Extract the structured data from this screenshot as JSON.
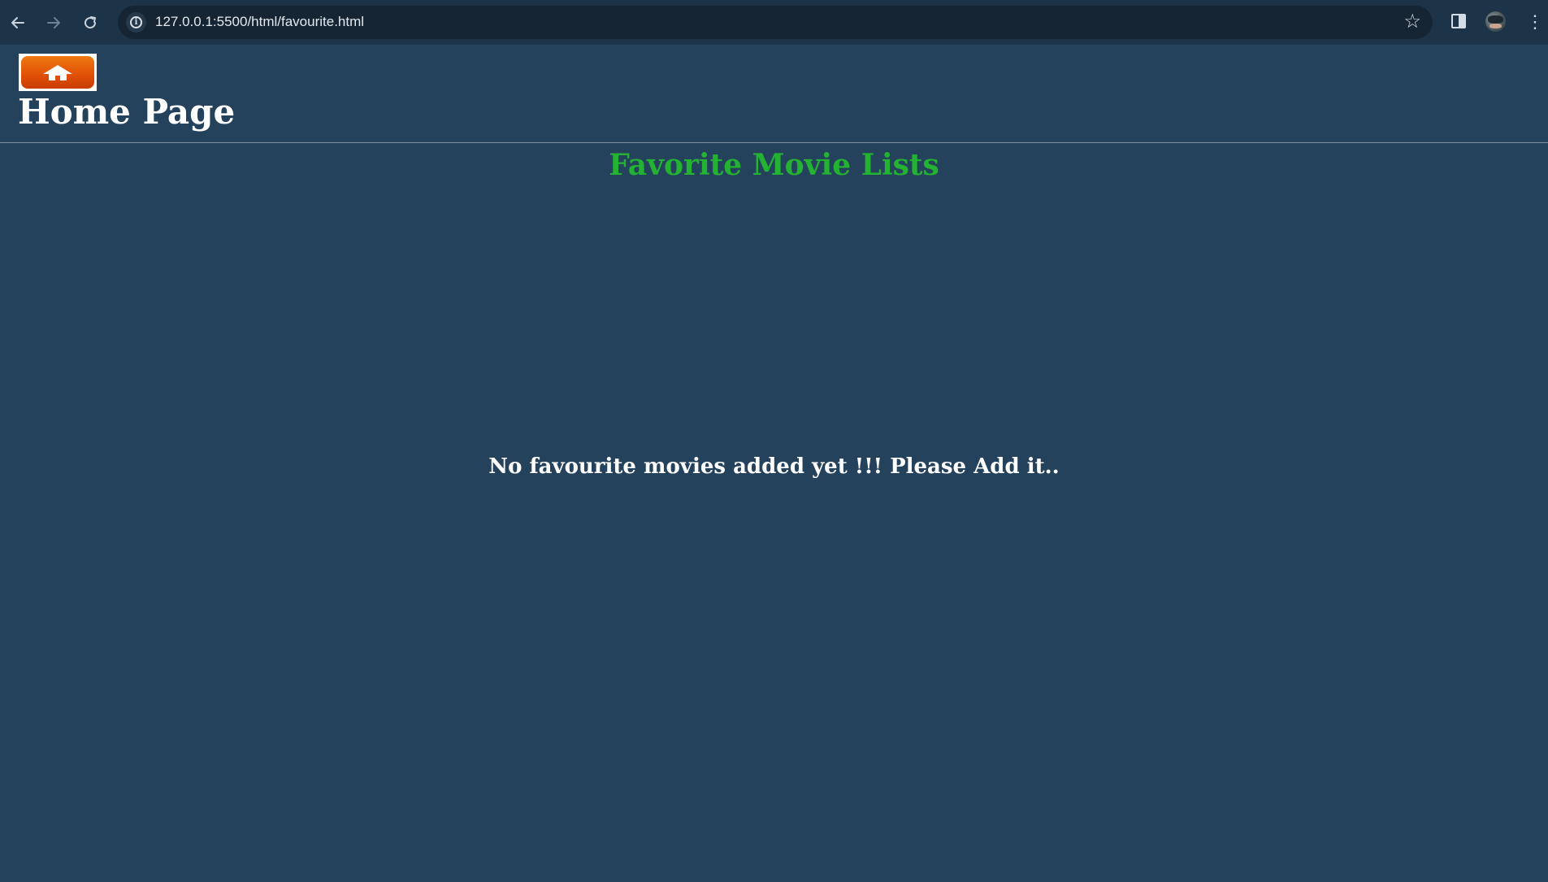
{
  "browser": {
    "url": "127.0.0.1:5500/html/favourite.html",
    "back_icon": "arrow-left-icon",
    "forward_icon": "arrow-right-icon",
    "reload_icon": "reload-icon",
    "site_info_icon": "info-icon",
    "bookmark_icon": "star-icon",
    "side_panel_icon": "side-panel-icon",
    "profile_icon": "avatar",
    "menu_icon": "more-vertical-icon"
  },
  "header": {
    "home_button_icon": "home-icon",
    "title": "Home Page"
  },
  "main": {
    "heading": "Favorite Movie Lists",
    "empty_message": "No favourite movies added yet !!! Please Add it.."
  },
  "colors": {
    "background": "#25425d",
    "heading": "#23b232",
    "text": "#ffffff",
    "home_button": "#e04f06"
  }
}
